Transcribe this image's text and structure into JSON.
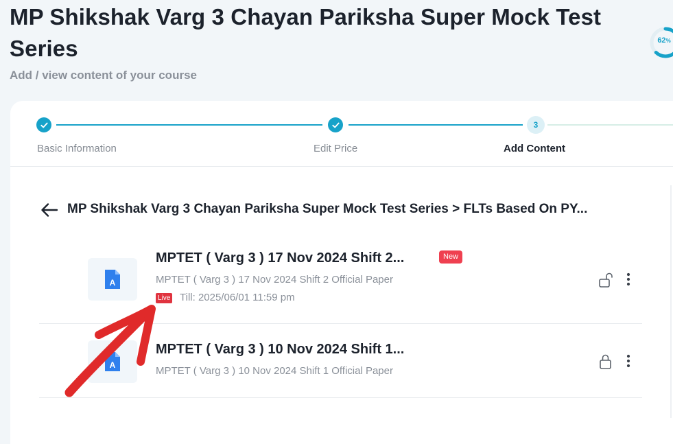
{
  "page": {
    "title": "MP Shikshak Varg 3 Chayan Pariksha Super Mock Test Series",
    "subtitle": "Add / view content of your course",
    "progress_value": "62",
    "progress_unit": "%",
    "progress_fraction": 0.62
  },
  "stepper": {
    "steps": [
      {
        "label": "Basic Information",
        "status": "done"
      },
      {
        "label": "Edit Price",
        "status": "done"
      },
      {
        "label": "Add Content",
        "status": "active",
        "number": "3"
      }
    ]
  },
  "breadcrumb": {
    "text": "MP Shikshak Varg 3 Chayan Pariksha Super Mock Test Series > FLTs Based On PY..."
  },
  "items": [
    {
      "title": "MPTET ( Varg 3 ) 17 Nov 2024 Shift 2...",
      "badge": "New",
      "description": "MPTET ( Varg 3 ) 17 Nov 2024 Shift 2 Official Paper",
      "live_label": "Live",
      "till": "Till: 2025/06/01 11:59 pm",
      "lock": "unlock-icon"
    },
    {
      "title": "MPTET ( Varg 3 ) 10 Nov 2024 Shift 1...",
      "description": "MPTET ( Varg 3 ) 10 Nov 2024 Shift 1 Official Paper",
      "lock": "lock-icon"
    }
  ],
  "colors": {
    "accent": "#17a2c9",
    "badge_red": "#ef4050",
    "annotation_red": "#e02a2a",
    "doc_blue": "#2f80ed"
  }
}
